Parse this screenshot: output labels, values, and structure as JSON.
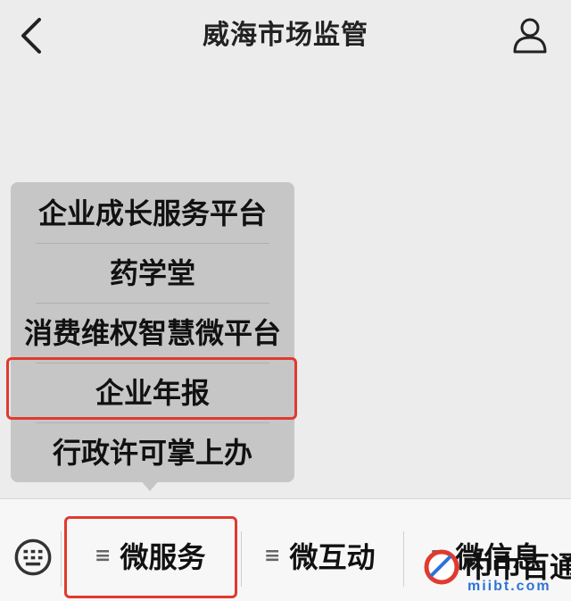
{
  "header": {
    "title": "威海市场监管",
    "back_icon": "chevron-left-icon",
    "profile_icon": "user-icon"
  },
  "popup_menu": {
    "items": [
      {
        "label": "企业成长服务平台"
      },
      {
        "label": "药学堂"
      },
      {
        "label": "消费维权智慧微平台"
      },
      {
        "label": "企业年报",
        "highlighted": true
      },
      {
        "label": "行政许可掌上办"
      }
    ]
  },
  "bottom_bar": {
    "keyboard_icon": "keyboard-icon",
    "tabs": [
      {
        "label": "微服务",
        "highlighted": true
      },
      {
        "label": "微互动"
      },
      {
        "label": "微信息"
      }
    ]
  },
  "watermark": {
    "brand": "巾巾百通",
    "url": "miibt.com"
  },
  "colors": {
    "highlight_border": "#e03a2f",
    "popup_bg": "#c6c6c6",
    "page_bg": "#ececec",
    "bar_bg": "#f7f7f7",
    "watermark_url": "#2d73d6"
  }
}
